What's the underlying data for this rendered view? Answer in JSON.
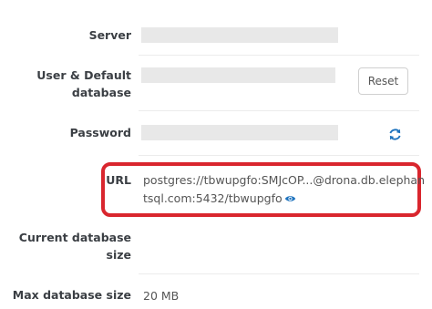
{
  "fields": {
    "server": {
      "label": "Server"
    },
    "user": {
      "label": "User & Default database",
      "reset_label": "Reset"
    },
    "password": {
      "label": "Password"
    },
    "url": {
      "label": "URL",
      "value_line1": "postgres://tbwupgfo:SMJcOP...@drona.db.elephan",
      "value_line2": "tsql.com:5432/tbwupgfo"
    },
    "current_size": {
      "label": "Current database size",
      "value": ""
    },
    "max_size": {
      "label": "Max database size",
      "value": "20 MB"
    }
  },
  "icons": {
    "refresh": "refresh-icon",
    "eye": "eye-icon"
  },
  "colors": {
    "highlight": "#d9262e",
    "accent": "#1e73be"
  }
}
